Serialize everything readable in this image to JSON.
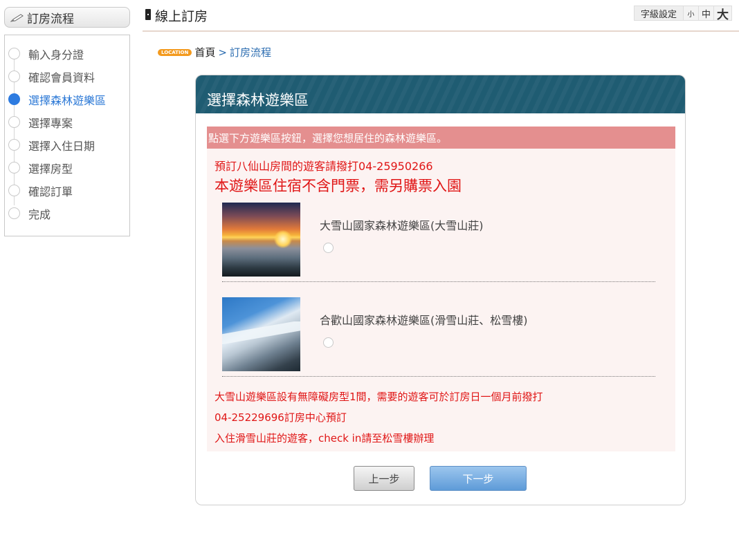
{
  "sidebar": {
    "title": "訂房流程",
    "steps": [
      {
        "label": "輸入身分證",
        "active": false
      },
      {
        "label": "確認會員資料",
        "active": false
      },
      {
        "label": "選擇森林遊樂區",
        "active": true
      },
      {
        "label": "選擇專案",
        "active": false
      },
      {
        "label": "選擇入住日期",
        "active": false
      },
      {
        "label": "選擇房型",
        "active": false
      },
      {
        "label": "確認訂單",
        "active": false
      },
      {
        "label": "完成",
        "active": false
      }
    ]
  },
  "header": {
    "title": "線上訂房",
    "font_setting_label": "字級設定",
    "font_small": "小",
    "font_medium": "中",
    "font_large": "大"
  },
  "breadcrumb": {
    "badge": "LOCATION",
    "home": "首頁",
    "separator": ">",
    "current": "訂房流程"
  },
  "panel": {
    "title": "選擇森林遊樂區",
    "notice": "點選下方遊樂區按鈕，選擇您想居住的森林遊樂區。",
    "phone_notice": "預訂八仙山房間的遊客請撥打04-25950266",
    "ticket_notice": "本遊樂區住宿不含門票，需另購票入園",
    "areas": [
      {
        "name": "大雪山國家森林遊樂區(大雪山莊)",
        "image": "sunrise-sea-of-clouds",
        "selected": false
      },
      {
        "name": "合歡山國家森林遊樂區(滑雪山莊、松雪樓)",
        "image": "snowy-mountain",
        "selected": false
      }
    ],
    "notes": [
      "大雪山遊樂區設有無障礙房型1間，需要的遊客可於訂房日一個月前撥打",
      "04-25229696訂房中心預訂",
      "入住滑雪山莊的遊客，check in請至松雪樓辦理"
    ],
    "prev_label": "上一步",
    "next_label": "下一步"
  },
  "colors": {
    "panel_header": "#1f5c72",
    "notice_bar": "#e48f8f",
    "alert_text": "#e01515",
    "active_step": "#2d7be0",
    "location_badge": "#f39a1e"
  }
}
